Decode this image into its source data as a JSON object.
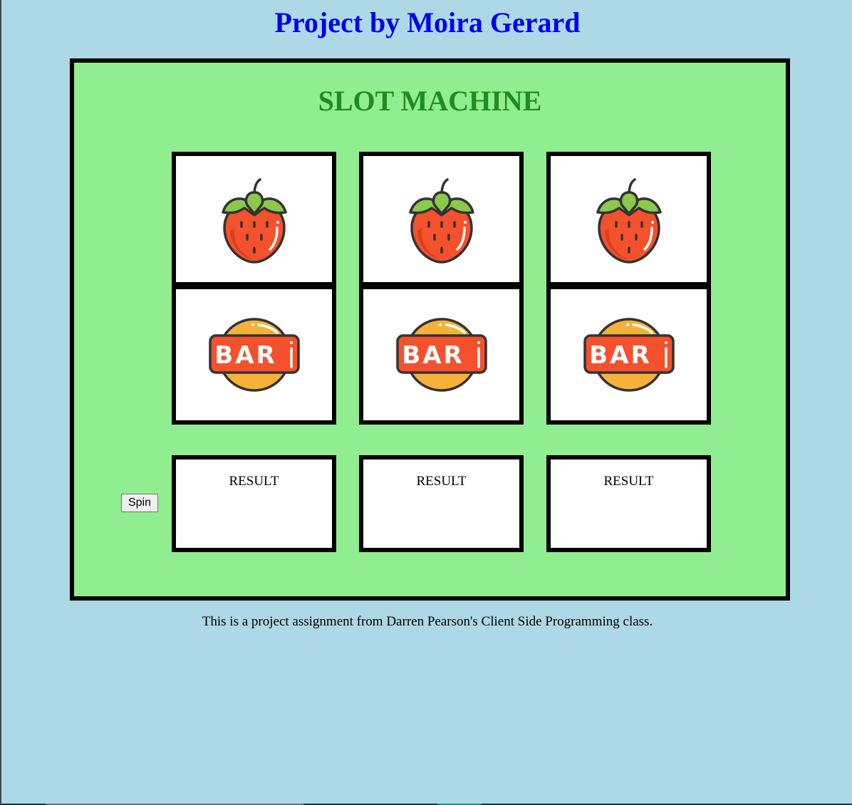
{
  "page": {
    "title": "Project by Moira Gerard",
    "footer": "This is a project assignment from Darren Pearson's Client Side Programming class."
  },
  "machine": {
    "title": "SLOT MACHINE",
    "reels_top": [
      {
        "symbol": "strawberry-icon"
      },
      {
        "symbol": "strawberry-icon"
      },
      {
        "symbol": "strawberry-icon"
      }
    ],
    "reels_bottom": [
      {
        "symbol": "bar-icon",
        "label": "BAR"
      },
      {
        "symbol": "bar-icon",
        "label": "BAR"
      },
      {
        "symbol": "bar-icon",
        "label": "BAR"
      }
    ],
    "results": [
      "RESULT",
      "RESULT",
      "RESULT"
    ],
    "spin_label": "Spin"
  },
  "colors": {
    "page_background": "#add8e6",
    "title_color": "#0000ee",
    "machine_background": "#90ee90",
    "machine_title_color": "#228b22"
  }
}
